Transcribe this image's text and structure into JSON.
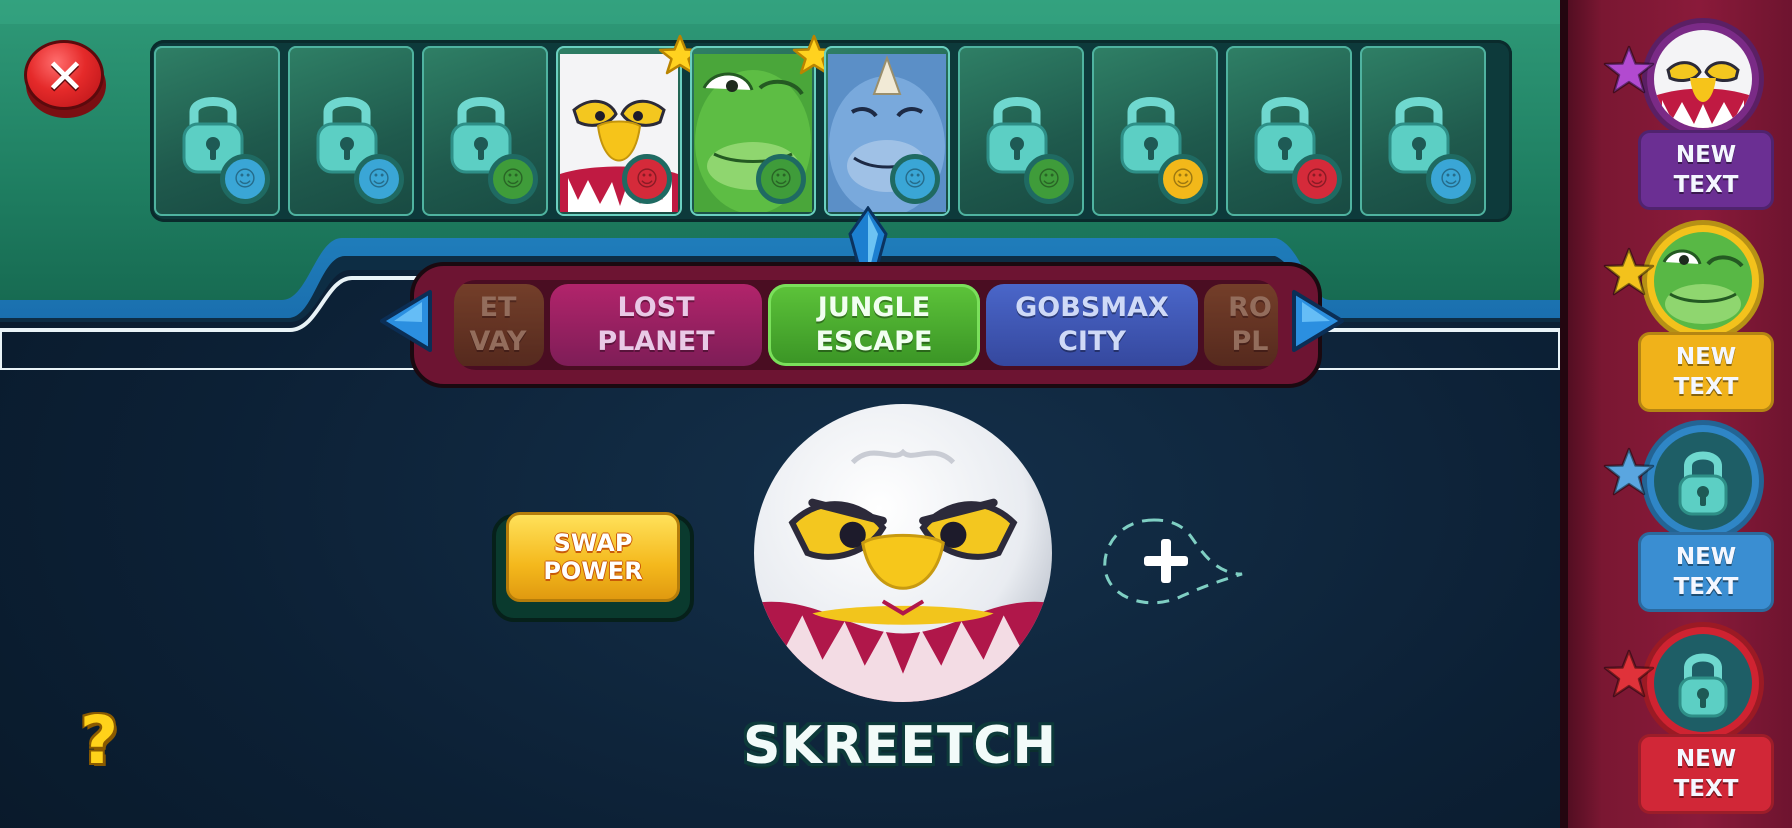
{
  "close_icon": "close-x-icon",
  "strip": {
    "cards": [
      {
        "state": "locked",
        "element": "water",
        "color": "#3aa6d6"
      },
      {
        "state": "locked",
        "element": "water",
        "color": "#3aa6d6"
      },
      {
        "state": "locked",
        "element": "nature",
        "color": "#3f9c3a"
      },
      {
        "state": "unlocked",
        "character": "eagle",
        "element": "fire",
        "color": "#d52a3a",
        "star": true
      },
      {
        "state": "unlocked",
        "character": "frog",
        "element": "nature",
        "color": "#3f9c3a",
        "star": true
      },
      {
        "state": "unlocked",
        "character": "rhino",
        "element": "water",
        "color": "#3aa6d6"
      },
      {
        "state": "locked",
        "element": "nature",
        "color": "#3f9c3a"
      },
      {
        "state": "locked",
        "element": "electric",
        "color": "#f2b81a"
      },
      {
        "state": "locked",
        "element": "fire",
        "color": "#d52a3a"
      },
      {
        "state": "locked",
        "element": "water",
        "color": "#3aa6d6"
      }
    ]
  },
  "worlds": {
    "left_partial": [
      "ET",
      "VAY"
    ],
    "items": [
      {
        "line1": "LOST",
        "line2": "PLANET"
      },
      {
        "line1": "JUNGLE",
        "line2": "ESCAPE"
      },
      {
        "line1": "GOBSMAX",
        "line2": "CITY"
      }
    ],
    "right_partial": [
      "RO",
      "PL"
    ],
    "selected": "JUNGLE ESCAPE"
  },
  "swap_power": {
    "line1": "SWAP",
    "line2": "POWER"
  },
  "hero": {
    "name": "SKREETCH"
  },
  "add_icon": "plus-icon",
  "help": {
    "label": "?"
  },
  "sidebar": {
    "slots": [
      {
        "line1": "NEW",
        "line2": "TEXT",
        "ring": "#7a2a86",
        "label_bg": "#6b2f93",
        "star": "#b24ad0",
        "content": "eagle"
      },
      {
        "line1": "NEW",
        "line2": "TEXT",
        "ring": "#f3c21c",
        "label_bg": "#f0b21a",
        "star": "#f3c21c",
        "content": "frog"
      },
      {
        "line1": "NEW",
        "line2": "TEXT",
        "ring": "#2f86c6",
        "label_bg": "#3a8ed2",
        "star": "#5aa6e0",
        "content": "locked"
      },
      {
        "line1": "NEW",
        "line2": "TEXT",
        "ring": "#cf2331",
        "label_bg": "#d12737",
        "star": "#e0323a",
        "content": "locked"
      }
    ]
  }
}
